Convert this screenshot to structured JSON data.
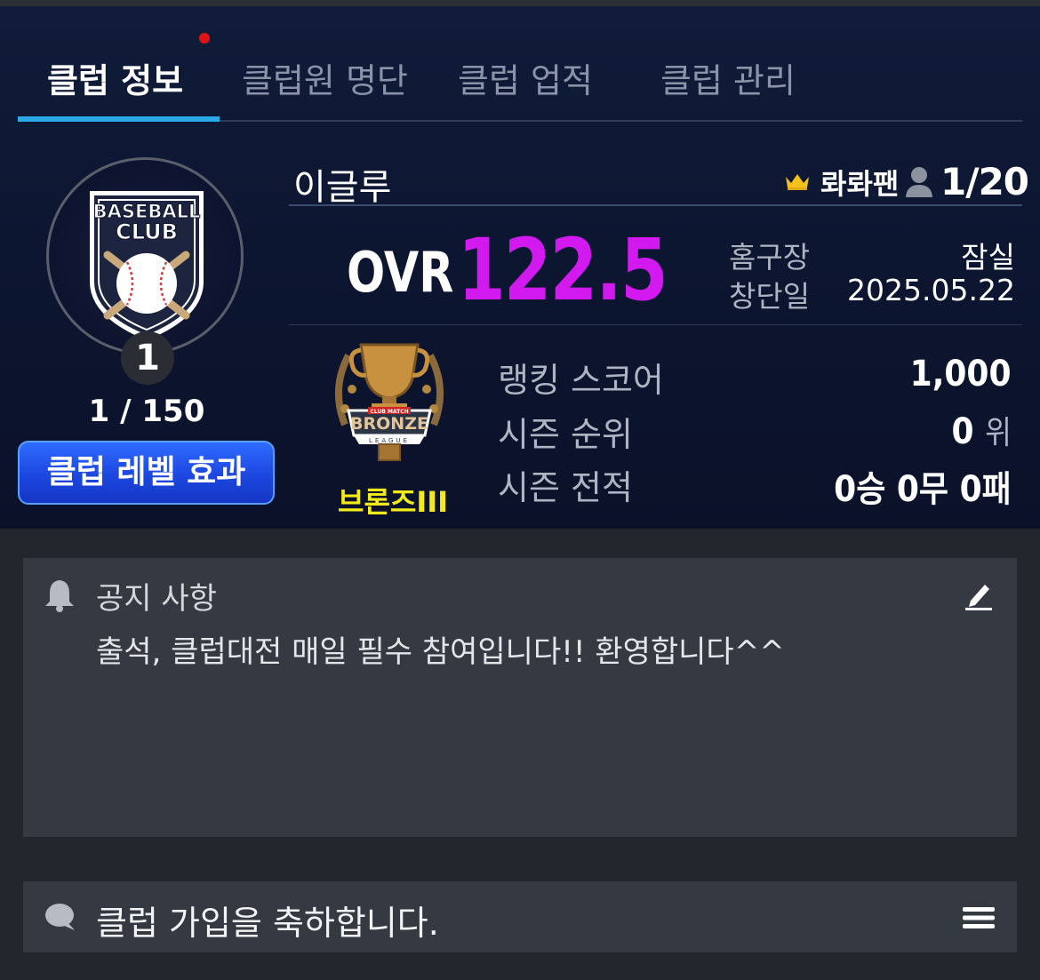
{
  "tabs": [
    {
      "label": "클럽 정보",
      "active": true
    },
    {
      "label": "클럽원 명단",
      "active": false
    },
    {
      "label": "클럽 업적",
      "active": false
    },
    {
      "label": "클럽 관리",
      "active": false
    }
  ],
  "emblem": {
    "line1": "BASEBALL",
    "line2": "CLUB"
  },
  "club": {
    "level": "1",
    "level_progress": "1 / 150",
    "level_button": "클럽 레벨 효과",
    "name": "이글루",
    "leader": "롸롸팬",
    "members": "1/20",
    "ovr_label": "OVR",
    "ovr_value": "122.5",
    "home_label": "홈구장",
    "home_value": "잠실",
    "founded_label": "창단일",
    "founded_value": "2025.05.22"
  },
  "league": {
    "badge_top": "CLUB MATCH",
    "badge_name": "BRONZE",
    "badge_bottom": "LEAGUE",
    "name": "브론즈III",
    "ranking_label": "랭킹 스코어",
    "ranking_value": "1,000",
    "rank_label": "시즌 순위",
    "rank_value": "0",
    "rank_unit": "위",
    "record_label": "시즌 전적",
    "record_value": "0승 0무 0패"
  },
  "notice": {
    "title": "공지 사항",
    "body": "출석, 클럽대전 매일 필수 참여입니다!! 환영합니다^^"
  },
  "chat": {
    "message": "클럽 가입을 축하합니다."
  },
  "colors": {
    "accent_tab": "#29a9e6",
    "ovr": "#d21af0",
    "league_name": "#f3ea19",
    "button": "#1c47e0"
  },
  "icons": [
    "crown-icon",
    "person-icon",
    "bell-icon",
    "edit-icon",
    "chat-bubble-icon",
    "menu-icon"
  ]
}
